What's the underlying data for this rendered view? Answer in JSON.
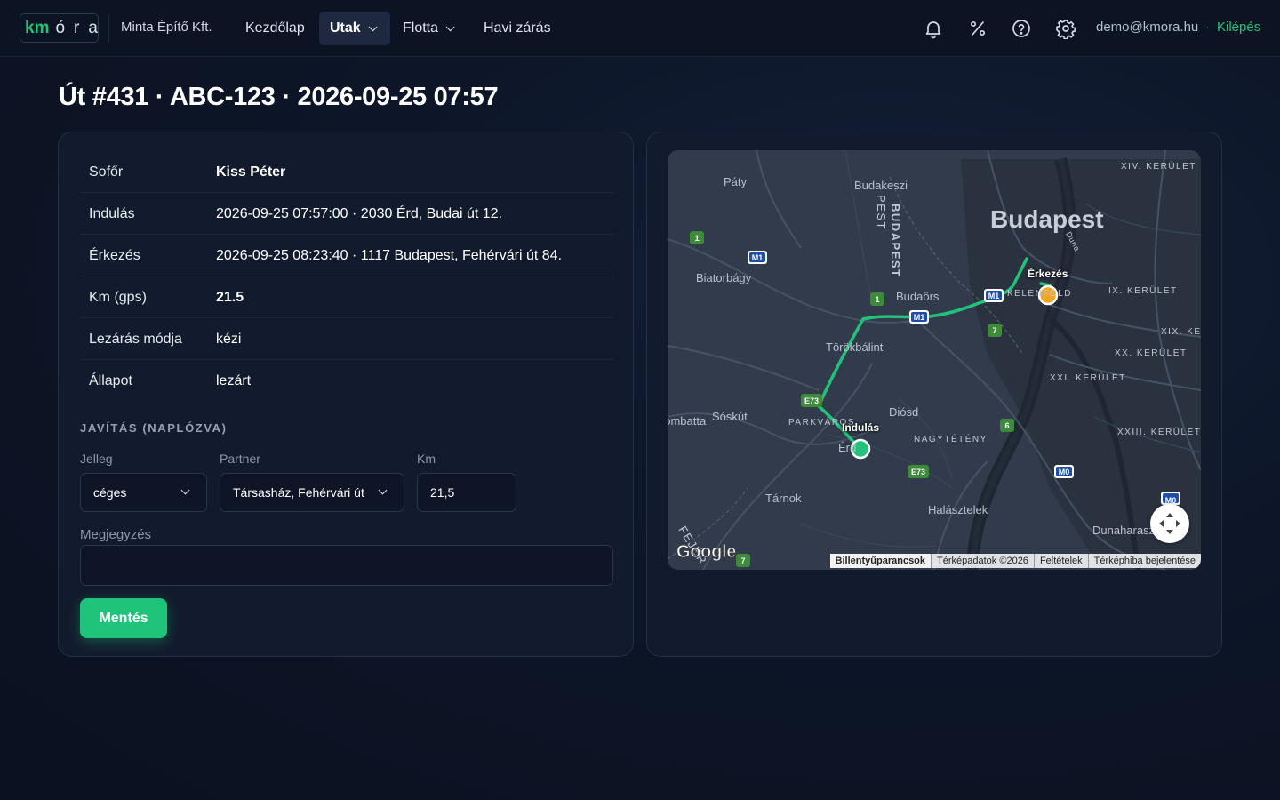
{
  "nav": {
    "logo_km": "km",
    "logo_ora": "óra",
    "company": "Minta Építő Kft.",
    "items": [
      {
        "label": "Kezdőlap"
      },
      {
        "label": "Utak"
      },
      {
        "label": "Flotta"
      },
      {
        "label": "Havi zárás"
      }
    ],
    "icons": [
      "bell-icon",
      "percent-icon",
      "help-circle-icon",
      "gear-icon"
    ],
    "user_email": "demo@kmora.hu",
    "separator": "·",
    "logout_label": "Kilépés"
  },
  "page": {
    "title": "Út #431 · ABC-123 · 2026-09-25 07:57"
  },
  "details": [
    {
      "label": "Sofőr",
      "value": "Kiss Péter"
    },
    {
      "label": "Indulás",
      "value": "2026-09-25 07:57:00 · 2030 Érd, Budai út 12."
    },
    {
      "label": "Érkezés",
      "value": "2026-09-25 08:23:40 · 1117 Budapest, Fehérvári út 84."
    },
    {
      "label": "Km (gps)",
      "value": "21.5"
    },
    {
      "label": "Lezárás módja",
      "value": "kézi"
    },
    {
      "label": "Állapot",
      "value": "lezárt"
    }
  ],
  "correction": {
    "section_title": "JAVÍTÁS (NAPLÓZVA)",
    "jelleg_label": "Jelleg",
    "jelleg_value": "céges",
    "partner_label": "Partner",
    "partner_value": "Társasház, Fehérvári út",
    "km_label": "Km",
    "km_value": "21,5",
    "note_label": "Megjegyzés",
    "note_value": "",
    "save_label": "Mentés"
  },
  "map": {
    "city": "Budapest",
    "start_label": "Indulás",
    "end_label": "Érkezés",
    "colors": {
      "route": "#22c27a",
      "start": "#22c27a",
      "end": "#f5a524"
    },
    "places": [
      "Páty",
      "Budakeszi",
      "Biatorbágy",
      "Budaörs",
      "Törökbálint",
      "Diósd",
      "Sóskút",
      "Tárnok",
      "Százhalombatta",
      "Halásztelek",
      "Dunaharaszti",
      "Érd"
    ],
    "districts": [
      "XIV. KERÜLET",
      "IX. KERÜLET",
      "XIX. KERÜLET",
      "XX. KERÜLET",
      "XXI. KERÜLET",
      "XXIII. KERÜLET",
      "NAGYTÉTÉNY",
      "KELENFÖLD",
      "PARKVÁROS"
    ],
    "regions": [
      "BUDAPEST",
      "PEST",
      "FEJÉR"
    ],
    "river": "Duna",
    "road_shields": [
      "M1",
      "M1",
      "M1",
      "M0",
      "M0",
      "E73",
      "E73",
      "1",
      "1",
      "7",
      "7",
      "6"
    ],
    "attribution": [
      "Billentyűparancsok",
      "Térképadatok ©2026",
      "Feltételek",
      "Térképhiba bejelentése"
    ],
    "brand": "Google"
  }
}
